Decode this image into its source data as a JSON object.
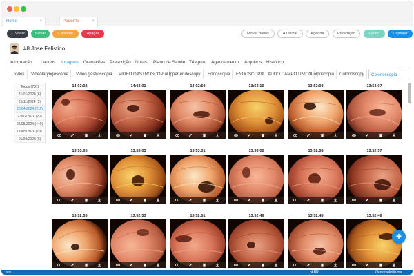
{
  "browser": {
    "tabs": [
      {
        "label": "Home"
      },
      {
        "label": "Paciente"
      }
    ],
    "close_glyph": "×"
  },
  "toolbar": {
    "back_label": "← Voltar",
    "save_label": "Salvar",
    "cancel_label": "Cancelar",
    "delete_label": "Apagar",
    "move_label": "Mover dados",
    "refresh_label": "Atualizar",
    "schedule_label": "Agenda",
    "prescription_label": "Prescrição",
    "laudo_label": "Laudo",
    "capture_label": "Capturar",
    "colors": {
      "dark": "#3a3f45",
      "save": "#3dbf7f",
      "cancel": "#f0a742",
      "delete": "#e23b4a",
      "laudo": "#7fd3c3",
      "capture": "#1a8fe3"
    }
  },
  "patient": {
    "name": "#8 Jose Felistino",
    "avatar_icon": "person-icon"
  },
  "nav": {
    "items": [
      "Informação",
      "Laudos",
      "Imagens",
      "Gravações",
      "Prescrição",
      "Notas",
      "Plano de Saúde",
      "Triagem",
      "Agendamento",
      "Arquivos",
      "Histórico"
    ],
    "active": "Imagens"
  },
  "subtabs": {
    "items": [
      "Todos",
      "Videolaryngoscopie",
      "Video gastroscopia",
      "VIDEO GASTROSCOPIA",
      "Upper endoscopy",
      "Endoscopia",
      "ENDOSCOPIA LAUDO CAMPO UNICO",
      "Colposcopia",
      "Colonoscopy",
      "Colonoscopia"
    ],
    "active": "Colonoscopia"
  },
  "dates": [
    {
      "label": "Todos (701)"
    },
    {
      "label": "31/01/2024 (6)"
    },
    {
      "label": "23/11/2024 (5)"
    },
    {
      "label": "23/04/2024 (211)",
      "active": true
    },
    {
      "label": "23/02/2024 (20)"
    },
    {
      "label": "22/08/2024 (440)"
    },
    {
      "label": "06/05/2024 (13)"
    },
    {
      "label": "01/09/2023 (6)"
    }
  ],
  "images": {
    "rows": [
      [
        "14:03:02",
        "14:03:01",
        "14:02:59",
        "13:53:10",
        "13:53:08",
        "13:53:07"
      ],
      [
        "13:53:05",
        "13:53:03",
        "13:53:01",
        "13:53:00",
        "13:52:58",
        "13:52:57"
      ],
      [
        "13:52:55",
        "13:52:53",
        "13:52:51",
        "13:52:49",
        "13:52:48",
        "13:52:46"
      ]
    ],
    "action_icons": [
      "eye-icon",
      "pencil-icon",
      "trash-icon",
      "download-icon"
    ]
  },
  "fab": {
    "label": "+"
  },
  "statusbar": {
    "left": "ace",
    "middle": "pt-BR",
    "right": "Desenvolvido por"
  }
}
